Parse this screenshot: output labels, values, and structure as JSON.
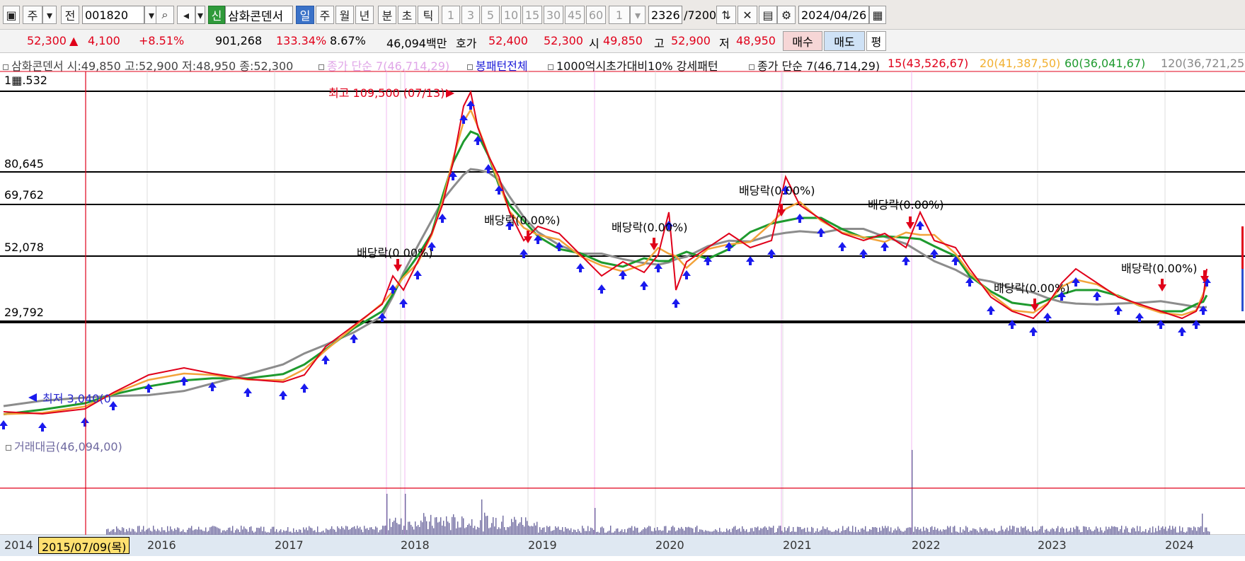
{
  "toolbar": {
    "period_label": "주",
    "prev_label": "전",
    "code": "001820",
    "new_badge": "신",
    "stock_name": "삼화콘덴서",
    "tab_day": "일",
    "tab_week": "주",
    "tab_month": "월",
    "tab_year": "년",
    "tab_min": "분",
    "tab_sec": "초",
    "tab_tick": "틱",
    "intervals": [
      "1",
      "3",
      "5",
      "10",
      "15",
      "30",
      "45",
      "60"
    ],
    "interval_select": "1",
    "count": "2326",
    "count_max": "/7200",
    "date": "2024/04/26"
  },
  "quote": {
    "price": "52,300",
    "change": "4,100",
    "change_pct": "+8.51%",
    "volume": "901,268",
    "vol_ratio": "133.34%",
    "turnover": "8.67%",
    "amount": "46,094백만",
    "hoga_label": "호가",
    "ask": "52,400",
    "bid": "52,300",
    "open_label": "시",
    "open": "49,850",
    "high_label": "고",
    "high": "52,900",
    "low_label": "저",
    "low": "48,950",
    "buy_label": "매수",
    "sell_label": "매도",
    "avg_label": "평"
  },
  "legend": {
    "ohlc": "삼화콘덴서 시:49,850 고:52,900 저:48,950 종:52,300",
    "ma_simple_faded": "종가 단순 7(46,714,29)",
    "pattern_all": "봉패턴전체",
    "pattern_strong": "1000억시초가대비10% 강세패턴",
    "ma_simple": "종가 단순 7(46,714,29)",
    "ma15": "15(43,526,67)",
    "ma20": "20(41,387,50)",
    "ma60": "60(36,041,67)",
    "ma120": "120(36,721,25)"
  },
  "levels": {
    "top": "1",
    "top_rest": ".532",
    "l1": "80,645",
    "l2": "69,762",
    "l3": "52,078",
    "l4": "29,792"
  },
  "annotations": {
    "high": "최고 109,500 (07/13)",
    "low": "최저 3,040(0",
    "div1": "배당락(0.00%)",
    "div2": "배당락(0.00%)",
    "div3": "배당락(0.00%)",
    "div4": "배당락(0.00%)",
    "div5": "배당락(0.00%)",
    "div6": "배당락(0.00%)",
    "div7": "배당락(0.00%)"
  },
  "volume_panel": {
    "label": "거래대금(46,094,00)"
  },
  "xaxis": {
    "selected": "2015/07/09(목)",
    "years": [
      "2014",
      "2016",
      "2017",
      "2018",
      "2019",
      "2020",
      "2021",
      "2022",
      "2023",
      "2024"
    ]
  },
  "colors": {
    "price_line": "#e0001a",
    "ma_orange": "#f2a33a",
    "ma_green": "#1e9a2e",
    "ma_gray": "#8c8c8c",
    "signal_blue": "#1a1aee",
    "volume": "#6f6aa0"
  }
}
